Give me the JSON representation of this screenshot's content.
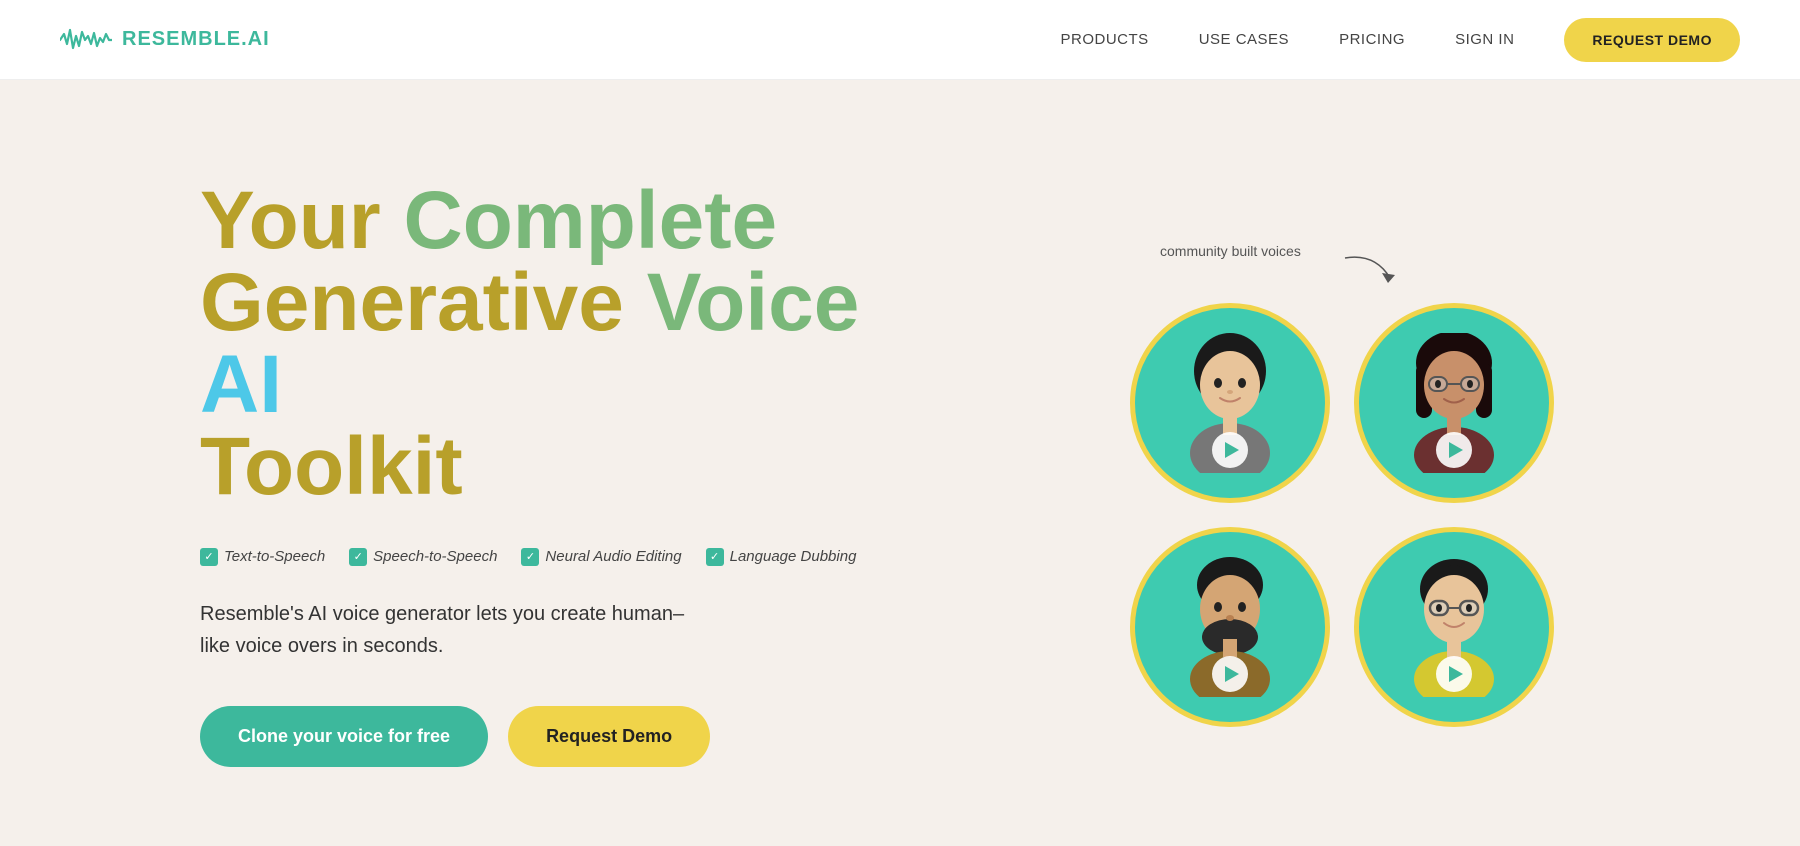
{
  "navbar": {
    "logo_text": "RESEMBLE.AI",
    "nav_items": [
      {
        "label": "PRODUCTS",
        "id": "products"
      },
      {
        "label": "USE CASES",
        "id": "use-cases"
      },
      {
        "label": "PRICING",
        "id": "pricing"
      },
      {
        "label": "SIGN IN",
        "id": "sign-in"
      }
    ],
    "cta_button": "REQUEST DEMO"
  },
  "hero": {
    "title_line1_word1": "Your",
    "title_line1_word2": "Complete",
    "title_line2_word1": "Generative",
    "title_line2_word2": "Voice",
    "title_line2_word3": "AI",
    "title_line3": "Toolkit",
    "features": [
      "Text-to-Speech",
      "Speech-to-Speech",
      "Neural Audio Editing",
      "Language Dubbing"
    ],
    "description": "Resemble's AI voice generator lets you create human–\nlike voice overs in seconds.",
    "btn_clone": "Clone your voice for free",
    "btn_demo": "Request Demo",
    "community_label": "community built voices"
  },
  "avatars": [
    {
      "id": "avatar-1",
      "emoji": "🧑‍💼",
      "color": "#3ecbb0"
    },
    {
      "id": "avatar-2",
      "emoji": "👩",
      "color": "#3ecbb0"
    },
    {
      "id": "avatar-3",
      "emoji": "🧔",
      "color": "#3ecbb0"
    },
    {
      "id": "avatar-4",
      "emoji": "👩‍🦱",
      "color": "#3ecbb0"
    }
  ]
}
